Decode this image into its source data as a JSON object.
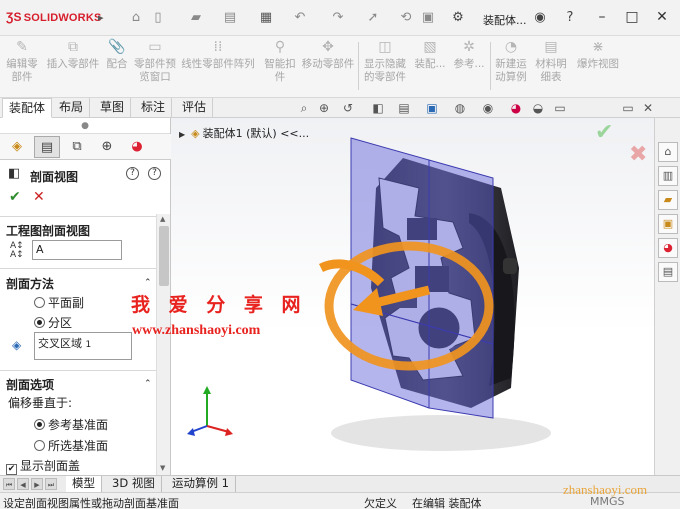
{
  "app": {
    "brand": "SOLIDWORKS",
    "doc_title": "装配体..."
  },
  "commands": [
    {
      "label": "编辑零\n部件"
    },
    {
      "label": "插入零部件"
    },
    {
      "label": "配合"
    },
    {
      "label": "零部件预\n览窗口"
    },
    {
      "label": "线性零部件阵列"
    },
    {
      "label": "智能扣\n件"
    },
    {
      "label": "移动零部件"
    },
    {
      "label": "显示隐藏\n的零部件"
    },
    {
      "label": "装配..."
    },
    {
      "label": "参考..."
    },
    {
      "label": "新建运\n动算例"
    },
    {
      "label": "材料明\n细表"
    },
    {
      "label": "爆炸视图"
    }
  ],
  "tabs": [
    "装配体",
    "布局",
    "草图",
    "标注",
    "评估"
  ],
  "tree": {
    "label": "装配体1 (默认) <<..."
  },
  "property_manager": {
    "title": "剖面视图",
    "ok": "✔",
    "cancel": "✕",
    "section_view_group": {
      "title": "工程图剖面视图",
      "name_value": "A"
    },
    "method_group": {
      "title": "剖面方法",
      "options": [
        "平面副",
        "分区"
      ],
      "selected": "分区",
      "list_value": "交叉区域",
      "list_index": "1"
    },
    "options_group": {
      "title": "剖面选项",
      "offset_label": "偏移垂直于:",
      "options": [
        "参考基准面",
        "所选基准面"
      ],
      "selected": "参考基准面",
      "show_cap_label": "显示剖面盖",
      "show_cap_checked": true
    }
  },
  "bottom_tabs": [
    "模型",
    "3D 视图",
    "运动算例 1"
  ],
  "status": {
    "hint": "设定剖面视图属性或拖动剖面基准面",
    "defined": "欠定义",
    "editing": "在编辑 装配体",
    "units": "MMGS"
  },
  "watermark": {
    "cn": "我 爱 分 享 网",
    "url": "www.zhanshaoyi.com",
    "url2": "zhanshaoyi.com"
  },
  "colors": {
    "accent": "#d61f2c",
    "arrow": "#f0941e",
    "plane": "#5a5ad6",
    "ok": "#2e8b2e",
    "cancel": "#cc2222",
    "watermark": "#e8231f"
  }
}
